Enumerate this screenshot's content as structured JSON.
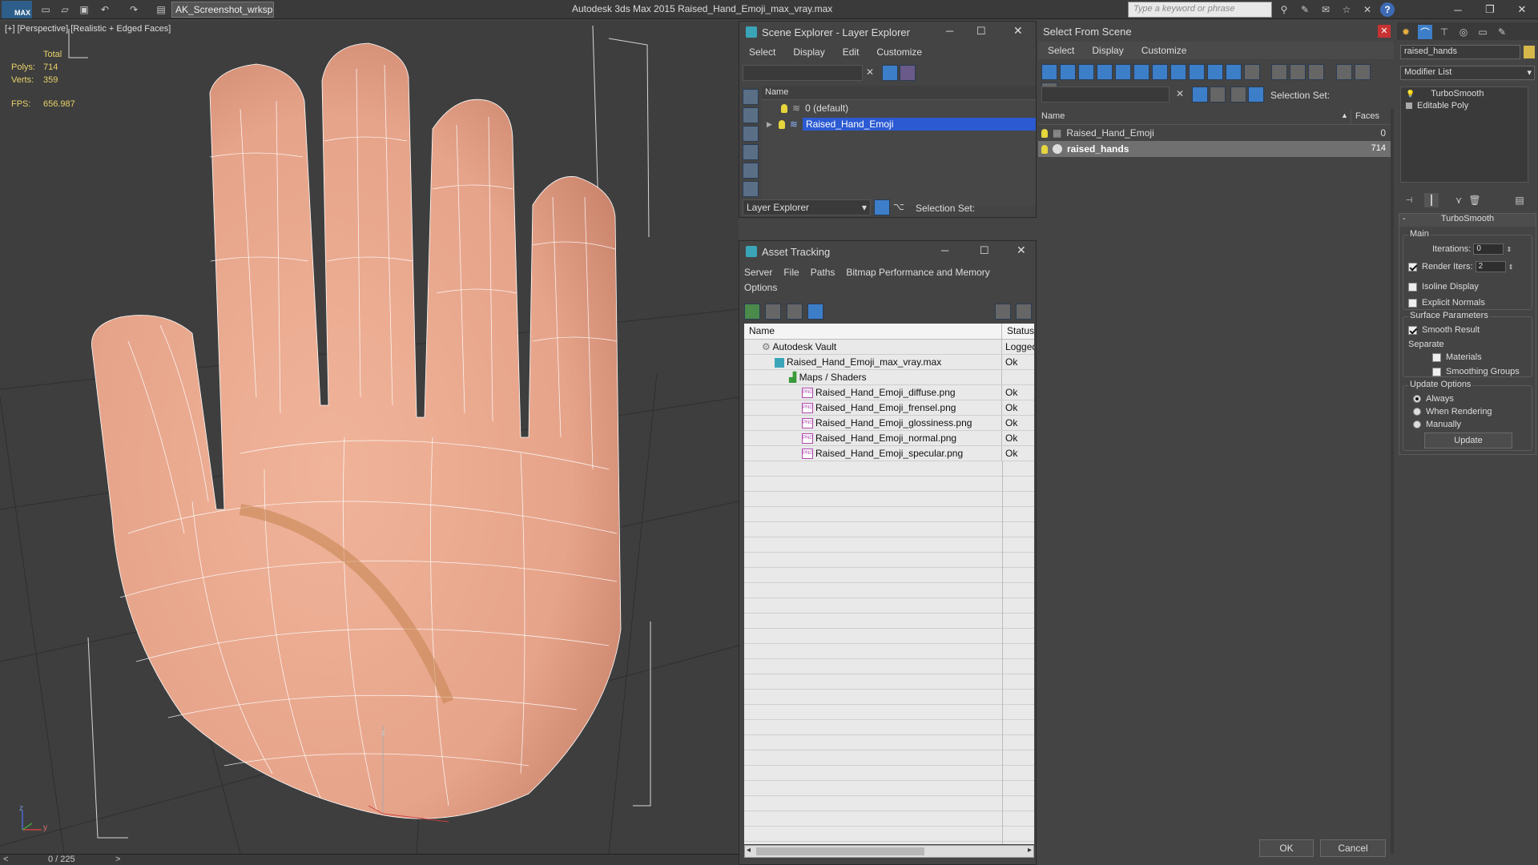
{
  "app": {
    "logo": "MAX",
    "workspace": "AK_Screenshot_wrksp",
    "title": "Autodesk 3ds Max  2015    Raised_Hand_Emoji_max_vray.max",
    "search_placeholder": "Type a keyword or phrase"
  },
  "viewport": {
    "label": "[+] [Perspective] [Realistic + Edged Faces]",
    "stats": {
      "header": "Total",
      "polys_label": "Polys:",
      "polys_value": "714",
      "verts_label": "Verts:",
      "verts_value": "359",
      "fps_label": "FPS:",
      "fps_value": "656.987"
    },
    "axis_z": "z",
    "axis_y": "y",
    "gizmo_z": "z"
  },
  "scene_explorer": {
    "title": "Scene Explorer - Layer Explorer",
    "menu": [
      "Select",
      "Display",
      "Edit",
      "Customize"
    ],
    "column_name": "Name",
    "layers": [
      {
        "label": "0 (default)",
        "selected": false
      },
      {
        "label": "Raised_Hand_Emoji",
        "selected": true
      }
    ],
    "footer_dropdown": "Layer Explorer",
    "footer_selection_set": "Selection Set:"
  },
  "asset_tracking": {
    "title": "Asset Tracking",
    "menu": [
      "Server",
      "File",
      "Paths",
      "Bitmap Performance and Memory",
      "Options"
    ],
    "col_name": "Name",
    "col_status": "Status",
    "rows": [
      {
        "name": "Autodesk Vault",
        "status": "Logged",
        "indent": 0,
        "icon": "vault"
      },
      {
        "name": "Raised_Hand_Emoji_max_vray.max",
        "status": "Ok",
        "indent": 1,
        "icon": "max"
      },
      {
        "name": "Maps / Shaders",
        "status": "",
        "indent": 2,
        "icon": "maps"
      },
      {
        "name": "Raised_Hand_Emoji_diffuse.png",
        "status": "Ok",
        "indent": 3,
        "icon": "png"
      },
      {
        "name": "Raised_Hand_Emoji_frensel.png",
        "status": "Ok",
        "indent": 3,
        "icon": "png"
      },
      {
        "name": "Raised_Hand_Emoji_glossiness.png",
        "status": "Ok",
        "indent": 3,
        "icon": "png"
      },
      {
        "name": "Raised_Hand_Emoji_normal.png",
        "status": "Ok",
        "indent": 3,
        "icon": "png"
      },
      {
        "name": "Raised_Hand_Emoji_specular.png",
        "status": "Ok",
        "indent": 3,
        "icon": "png"
      }
    ],
    "png_tag": "PNG"
  },
  "select_from_scene": {
    "title": "Select From Scene",
    "menu": [
      "Select",
      "Display",
      "Customize"
    ],
    "selection_set_label": "Selection Set:",
    "col_name": "Name",
    "col_faces": "Faces",
    "rows": [
      {
        "name": "Raised_Hand_Emoji",
        "faces": "0",
        "selected": false
      },
      {
        "name": "raised_hands",
        "faces": "714",
        "selected": true
      }
    ],
    "ok_label": "OK",
    "cancel_label": "Cancel"
  },
  "command_panel": {
    "object_name": "raised_hands",
    "object_color": "#d6b84a",
    "modifier_list": "Modifier List",
    "stack": [
      "TurboSmooth",
      "Editable Poly"
    ],
    "rollout_title": "TurboSmooth",
    "main_group": "Main",
    "iterations_label": "Iterations:",
    "iterations_value": "0",
    "render_iters_label": "Render Iters:",
    "render_iters_value": "2",
    "render_iters_checked": true,
    "isoline_label": "Isoline Display",
    "isoline_checked": false,
    "explicit_label": "Explicit Normals",
    "explicit_checked": false,
    "surface_group": "Surface Parameters",
    "smooth_result_label": "Smooth Result",
    "smooth_result_checked": true,
    "separate_label": "Separate",
    "materials_label": "Materials",
    "materials_checked": false,
    "smoothing_groups_label": "Smoothing Groups",
    "smoothing_groups_checked": false,
    "update_group": "Update Options",
    "always_label": "Always",
    "when_rendering_label": "When Rendering",
    "manually_label": "Manually",
    "update_mode": "always",
    "update_button": "Update"
  },
  "timeline": {
    "frame": "0 / 225",
    "prev": "<",
    "next": ">"
  },
  "colors": {
    "selection_blue": "#2b5ad2",
    "skin": "#e6a48a",
    "stats_yellow": "#e8d26a"
  }
}
